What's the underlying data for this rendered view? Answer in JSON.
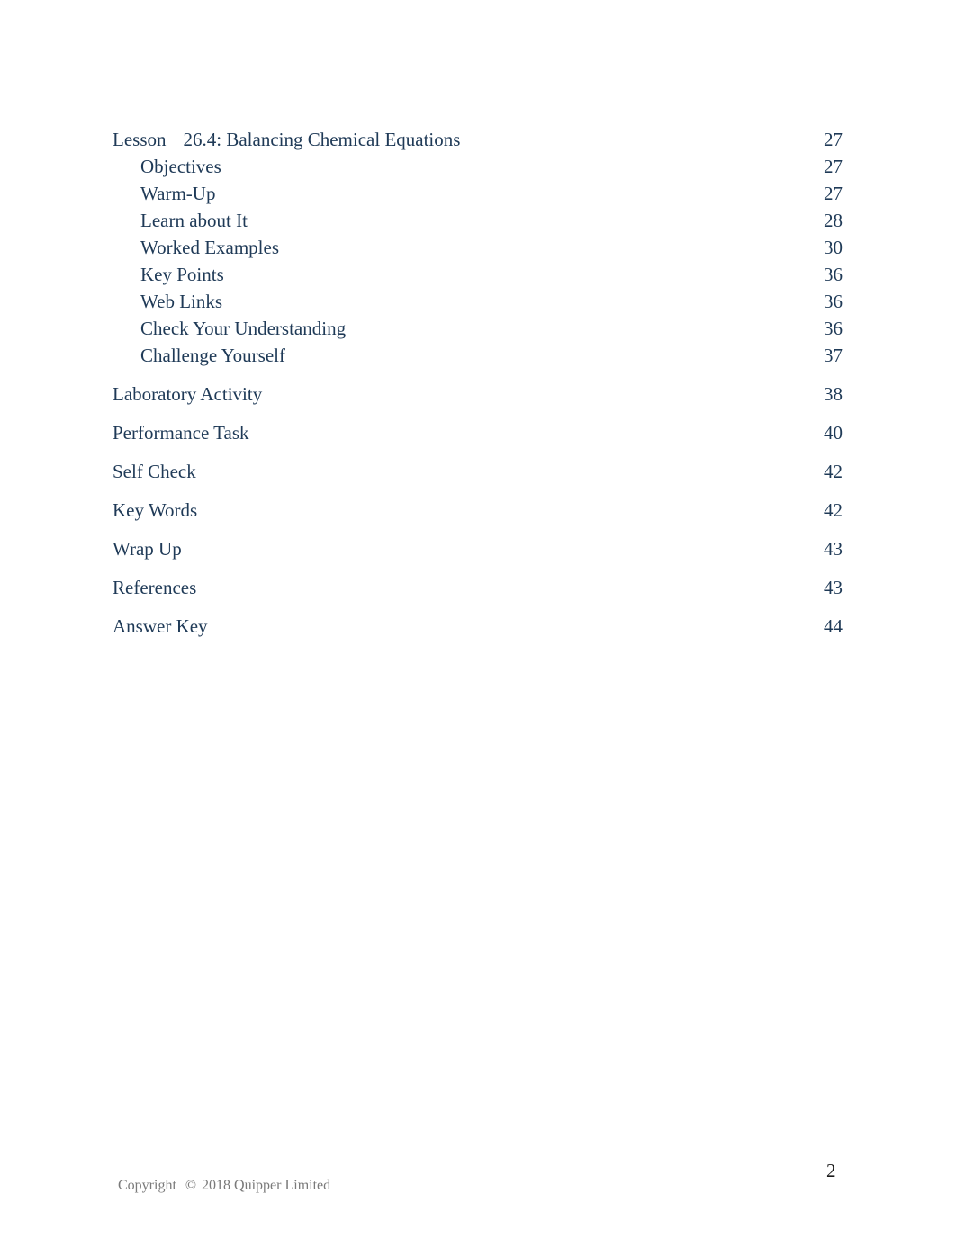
{
  "toc": {
    "lesson": {
      "prefix": "Lesson",
      "title": "26.4: Balancing Chemical Equations",
      "page": "27",
      "subsections": [
        {
          "label": "Objectives",
          "page": "27"
        },
        {
          "label": "Warm-Up",
          "page": "27"
        },
        {
          "label": "Learn about It",
          "page": "28"
        },
        {
          "label": "Worked Examples",
          "page": "30"
        },
        {
          "label": "Key Points",
          "page": "36"
        },
        {
          "label": "Web Links",
          "page": "36"
        },
        {
          "label": "Check Your Understanding",
          "page": "36"
        },
        {
          "label": "Challenge Yourself",
          "page": "37"
        }
      ]
    },
    "sections": [
      {
        "label": "Laboratory Activity",
        "page": "38"
      },
      {
        "label": "Performance Task",
        "page": "40"
      },
      {
        "label": "Self Check",
        "page": "42"
      },
      {
        "label": "Key Words",
        "page": "42"
      },
      {
        "label": "Wrap Up",
        "page": "43"
      },
      {
        "label": "References",
        "page": "43"
      },
      {
        "label": "Answer Key",
        "page": "44"
      }
    ]
  },
  "footer": {
    "copyright_label": "Copyright",
    "copyright_symbol": "©",
    "copyright_text": "2018 Quipper Limited",
    "page_number": "2"
  }
}
